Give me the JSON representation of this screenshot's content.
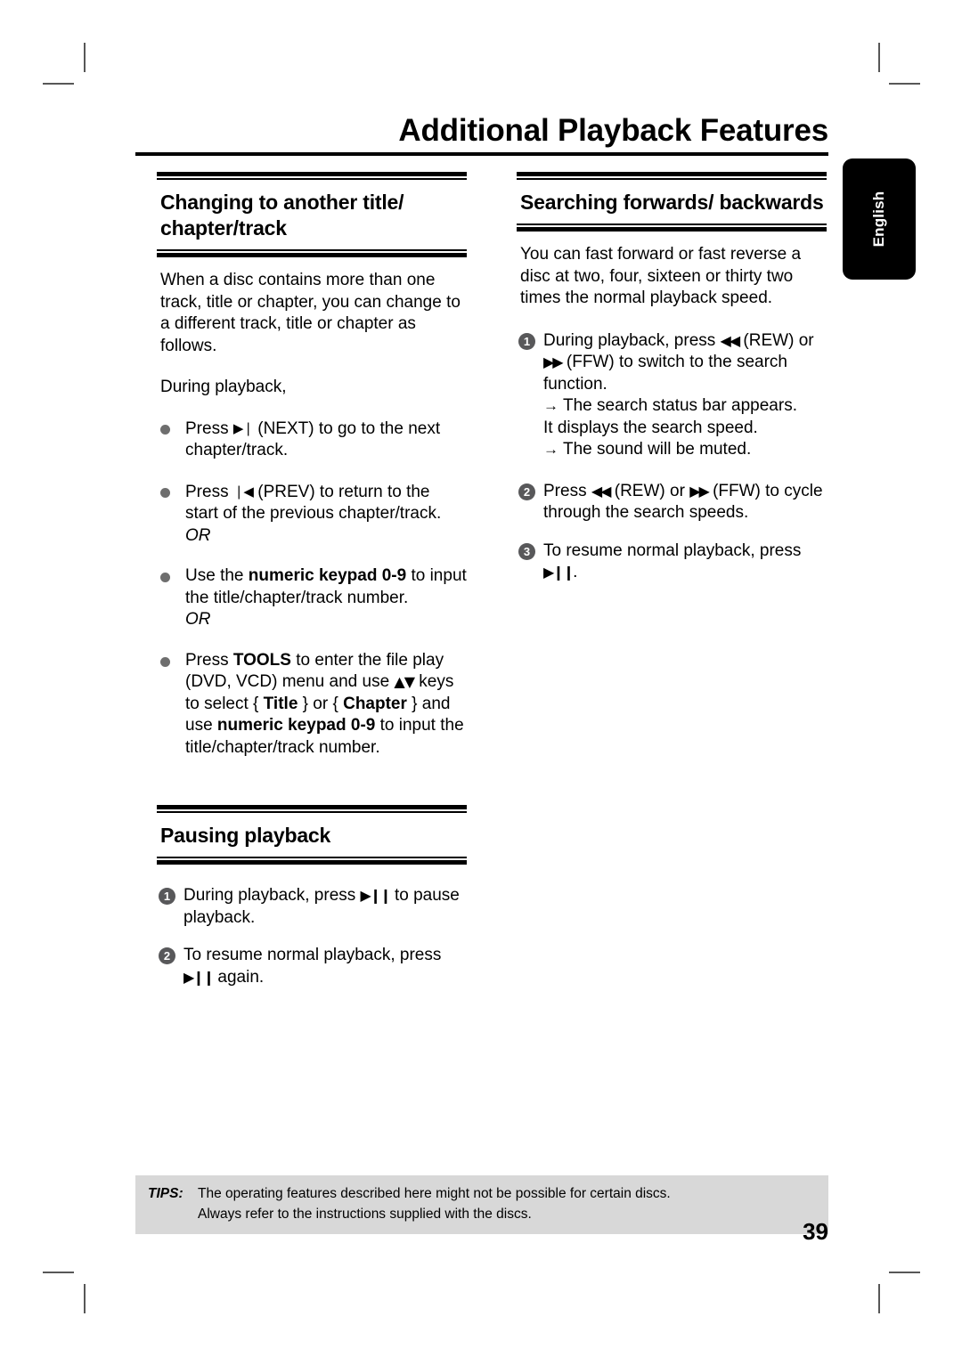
{
  "page": {
    "title": "Additional Playback Features",
    "number": "39",
    "language_tab": "English"
  },
  "left_column": {
    "section1": {
      "title": "Changing to another title/ chapter/track",
      "intro": "When a disc contains more than one track, title or chapter, you can change to a different track, title or chapter as follows.",
      "subintro": "During playback,",
      "bullets": [
        {
          "pre": "Press ",
          "glyph": "▶❘",
          "glyph_name": "next-track-icon",
          "post": " (NEXT) to go to the next chapter/track.",
          "or": ""
        },
        {
          "pre": "Press ",
          "glyph": "❘◀",
          "glyph_name": "prev-track-icon",
          "post": " (PREV) to return to the start of the previous chapter/track.",
          "or": "OR"
        },
        {
          "pre": "Use the ",
          "glyph": "",
          "glyph_name": "",
          "post": "",
          "or": "OR",
          "rich": "numeric-keypad"
        },
        {
          "pre": "Press ",
          "glyph": "",
          "glyph_name": "",
          "post": "",
          "or": "",
          "rich": "tools"
        }
      ],
      "bullet3": {
        "t1": "Use the ",
        "b1": "numeric keypad 0-9",
        "t2": " to input the title/chapter/track number.",
        "or": "OR"
      },
      "bullet4": {
        "t1": "Press ",
        "b1": "TOOLS",
        "t2": " to enter the file play (DVD, VCD) menu and use ",
        "arrows": "▲▼",
        "t3": " keys to select { ",
        "b2": "Title",
        "t4": " } or { ",
        "b3": "Chapter",
        "t5": " } and use ",
        "b4": "numeric keypad 0-9",
        "t6": " to input the title/chapter/track number."
      }
    },
    "section2": {
      "title": "Pausing playback",
      "steps": [
        {
          "num": "1",
          "t1": "During playback, press ",
          "glyph": "▶❙❙",
          "glyph_name": "play-pause-icon",
          "t2": " to pause playback."
        },
        {
          "num": "2",
          "t1": "To resume normal playback, press ",
          "glyph": "▶❙❙",
          "glyph_name": "play-pause-icon",
          "t2": " again."
        }
      ]
    }
  },
  "right_column": {
    "section1": {
      "title": "Searching forwards/ backwards",
      "intro": "You can fast forward or fast reverse a disc at two, four, sixteen or thirty two times the normal playback speed.",
      "step1": {
        "num": "1",
        "t1": "During playback, press ",
        "rew": "◀◀",
        "t2": " (REW) or ",
        "ffw": "▶▶",
        "t3": " (FFW) to switch to the search function.",
        "result1": "The search status bar appears.",
        "result1_cont": "It displays the search speed.",
        "result2": "The sound will be muted.",
        "arrow": "→"
      },
      "step2": {
        "num": "2",
        "t1": "Press ",
        "rew": "◀◀",
        "t2": " (REW) or ",
        "ffw": "▶▶",
        "t3": " (FFW) to cycle through the search speeds."
      },
      "step3": {
        "num": "3",
        "t1": "To resume normal playback, press ",
        "glyph": "▶❙❙",
        "t2": "."
      }
    }
  },
  "tips": {
    "label": "TIPS:",
    "line1": "The operating features described here might not be possible for certain discs.",
    "line2": "Always refer to the instructions supplied with the discs."
  }
}
